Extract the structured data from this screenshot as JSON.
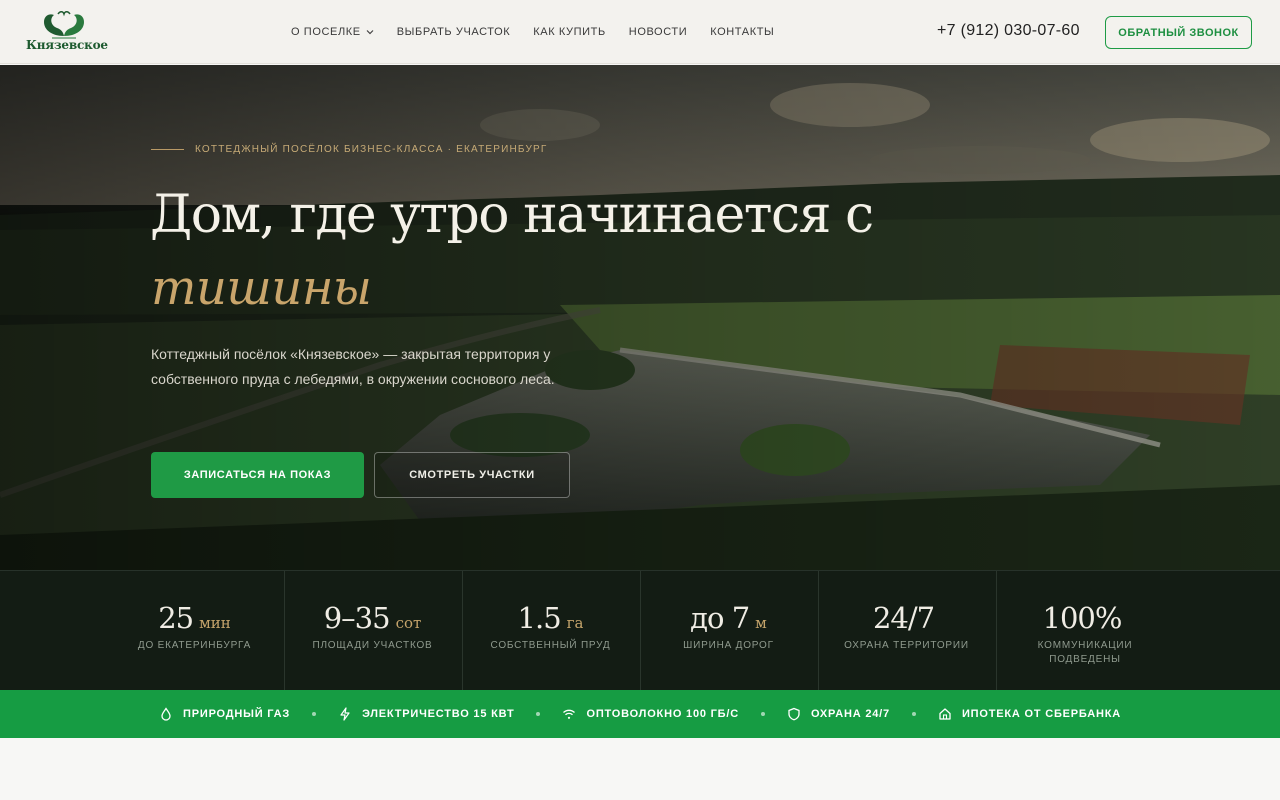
{
  "header": {
    "logo_text": "Князевское",
    "nav": [
      {
        "label": "О ПОСЕЛКЕ",
        "has_dropdown": true
      },
      {
        "label": "ВЫБРАТЬ УЧАСТОК"
      },
      {
        "label": "КАК КУПИТЬ"
      },
      {
        "label": "НОВОСТИ"
      },
      {
        "label": "КОНТАКТЫ"
      }
    ],
    "phone": "+7 (912) 030-07-60",
    "callback_label": "ОБРАТНЫЙ ЗВОНОК"
  },
  "hero": {
    "eyebrow": "КОТТЕДЖНЫЙ ПОСЁЛОК БИЗНЕС-КЛАССА · ЕКАТЕРИНБУРГ",
    "title": "Дом, где утро начинается с",
    "title_accent": "тишины",
    "lead": "Коттеджный посёлок «Князевское» — закрытая территория у собственного пруда с лебедями, в окружении соснового леса.",
    "primary_button": "ЗАПИСАТЬСЯ НА ПОКАЗ",
    "secondary_button": "СМОТРЕТЬ УЧАСТКИ"
  },
  "stats": [
    {
      "value": "25",
      "unit": "мин",
      "label": "ДО ЕКАТЕРИНБУРГА"
    },
    {
      "value": "9–35",
      "unit": "сот",
      "label": "ПЛОЩАДИ УЧАСТКОВ"
    },
    {
      "value": "1.5",
      "unit": "га",
      "label": "СОБСТВЕННЫЙ ПРУД"
    },
    {
      "value": "до 7",
      "unit": "м",
      "label": "ШИРИНА ДОРОГ"
    },
    {
      "value": "24/7",
      "unit": "",
      "label": "ОХРАНА ТЕРРИТОРИИ"
    },
    {
      "value": "100%",
      "unit": "",
      "label": "КОММУНИКАЦИИ ПОДВЕДЕНЫ"
    }
  ],
  "features": [
    {
      "icon": "drop-icon",
      "label": "ПРИРОДНЫЙ ГАЗ"
    },
    {
      "icon": "bolt-icon",
      "label": "ЭЛЕКТРИЧЕСТВО 15 КВТ"
    },
    {
      "icon": "wifi-icon",
      "label": "ОПТОВОЛОКНО 100 ГБ/С"
    },
    {
      "icon": "shield-icon",
      "label": "ОХРАНА 24/7"
    },
    {
      "icon": "home-icon",
      "label": "ИПОТЕКА ОТ СБЕРБАНКА"
    }
  ],
  "colors": {
    "accent_green": "#1f9a45",
    "gold": "#c9a56b",
    "dark_band": "#131c14"
  }
}
